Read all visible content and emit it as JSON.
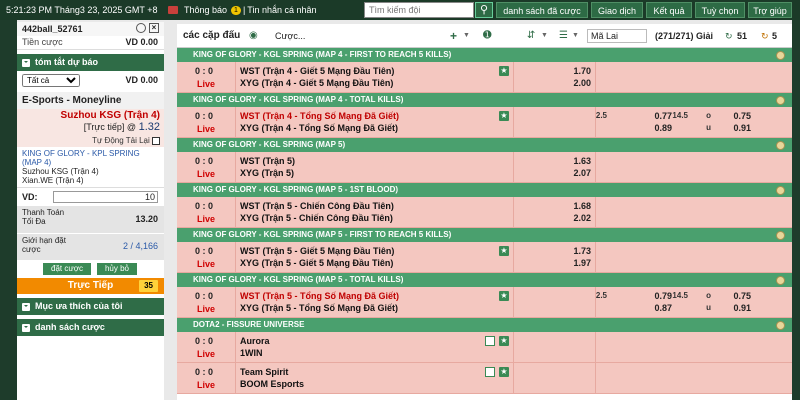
{
  "topbar": {
    "clock": "5:21:23 PM Tháng3 23, 2025 GMT +8",
    "notify_label": "Thông báo",
    "notify_count": "1",
    "messages_label": "Tin nhắn cá nhân",
    "search_placeholder": "Tìm kiếm đội",
    "search_icon": "search-icon",
    "buttons": [
      "danh sách đã cược",
      "Giao dịch",
      "Kết quả",
      "Tuỳ chọn",
      "Trợ giúp"
    ]
  },
  "left": {
    "username": "442ball_52761",
    "stake_label": "Tiền cược",
    "stake_value": "VD 0.00",
    "summary_title": "tóm tắt dự báo",
    "filter_select": "Tất cả",
    "filter_value": "VD 0.00",
    "bet_title": "E-Sports - Moneyline",
    "bet_team": "Suzhou KSG (Trận 4)",
    "bet_live_label": "[Trực tiếp] @",
    "bet_odds": "1.32",
    "auto_reload": "Tự Động Tải Lại",
    "league": "KING OF GLORY - KPL SPRING (MAP 4)",
    "team1": "Suzhou KSG (Trận 4)",
    "team2": "Xian.WE (Trận 4)",
    "vd_label": "VD:",
    "vd_value": "10",
    "max_payout_label1": "Thanh Toán",
    "max_payout_label2": "Tối Đa",
    "max_payout_value": "13.20",
    "limit_label1": "Giới hạn đặt",
    "limit_label2": "cược",
    "limit_value": "2 / 4,166",
    "place_bet": "đặt cược",
    "cancel": "hủy bỏ",
    "live_label": "Trực Tiếp",
    "live_count": "35",
    "favorites": "Mục ưa thích của tôi",
    "bet_list": "danh sách cược"
  },
  "main": {
    "title": "các cặp đấu",
    "live_tab": "Cược...",
    "odds_type": "Mã Lai",
    "count_label": "(271/271) Giải",
    "count_c": "51",
    "count_1": "5",
    "leagues": [
      {
        "name": "KING OF GLORY - KGL SPRING (MAP 4 - FIRST TO REACH 5 KILLS)",
        "score": "0 : 0",
        "live": "Live",
        "team1": "WST (Trận 4 - Giết 5 Mạng Đầu Tiên)",
        "team2": "XYG (Trận 4 - Giết 5 Mạng Đầu Tiên)",
        "odd1": "1.70",
        "odd2": "2.00"
      },
      {
        "name": "KING OF GLORY - KGL SPRING (MAP 4 - TOTAL KILLS)",
        "score": "0 : 0",
        "live": "Live",
        "team1": "WST (Trận 4 - Tổng Số Mạng Đã Giết)",
        "team2": "XYG (Trận 4 - Tổng Số Mạng Đã Giết)",
        "hcap": "2.5",
        "odd1": "0.77",
        "odd2": "0.89",
        "ou_line": "14.5",
        "ou1": "o",
        "ou2": "u",
        "ou_odd1": "0.75",
        "ou_odd2": "0.91"
      },
      {
        "name": "KING OF GLORY - KGL SPRING (MAP 5)",
        "score": "0 : 0",
        "live": "Live",
        "team1": "WST (Trận 5)",
        "team2": "XYG (Trận 5)",
        "odd1": "1.63",
        "odd2": "2.07"
      },
      {
        "name": "KING OF GLORY - KGL SPRING (MAP 5 - 1ST BLOOD)",
        "score": "0 : 0",
        "live": "Live",
        "team1": "WST (Trận 5 - Chiến Công Đầu Tiên)",
        "team2": "XYG (Trận 5 - Chiến Công Đầu Tiên)",
        "odd1": "1.68",
        "odd2": "2.02"
      },
      {
        "name": "KING OF GLORY - KGL SPRING (MAP 5 - FIRST TO REACH 5 KILLS)",
        "score": "0 : 0",
        "live": "Live",
        "team1": "WST (Trận 5 - Giết 5 Mạng Đầu Tiên)",
        "team2": "XYG (Trận 5 - Giết 5 Mạng Đầu Tiên)",
        "odd1": "1.73",
        "odd2": "1.97"
      },
      {
        "name": "KING OF GLORY - KGL SPRING (MAP 5 - TOTAL KILLS)",
        "score": "0 : 0",
        "live": "Live",
        "team1": "WST (Trận 5 - Tổng Số Mạng Đã Giết)",
        "team2": "XYG (Trận 5 - Tổng Số Mạng Đã Giết)",
        "hcap": "2.5",
        "odd1": "0.79",
        "odd2": "0.87",
        "ou_line": "14.5",
        "ou1": "o",
        "ou2": "u",
        "ou_odd1": "0.75",
        "ou_odd2": "0.91"
      },
      {
        "name": "DOTA2 - FISSURE UNIVERSE",
        "score": "0 : 0",
        "live": "Live",
        "team1": "Aurora",
        "team2": "1WIN",
        "score2": "0 : 0",
        "live2": "Live",
        "team3": "Team Spirit",
        "team4": "BOOM Esports"
      }
    ]
  },
  "colors": {
    "topbar_bg": "#1b3a28",
    "league_bar": "#4aa06e",
    "row_bg": "#f4c7c0",
    "live_red": "#d00000",
    "accent_orange": "#f28a00"
  }
}
